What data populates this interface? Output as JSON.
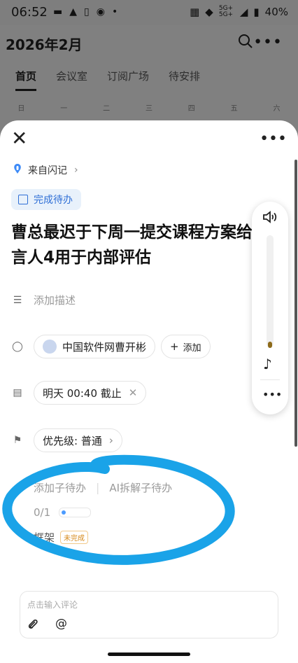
{
  "status_bar": {
    "time": "06:52",
    "network": "5G+ 5G+",
    "battery": "40%"
  },
  "background_app": {
    "month_title": "2026年2月",
    "tabs": [
      "首页",
      "会议室",
      "订阅广场",
      "待安排"
    ],
    "weekdays": [
      "日",
      "一",
      "二",
      "三",
      "四",
      "五",
      "六"
    ]
  },
  "sheet": {
    "source_label": "来自闪记",
    "todo_chip_label": "完成待办",
    "title": "曹总最迟于下周一提交课程方案给言人4用于内部评估",
    "title_line1": "曹总最迟于下周一提交课程方案给",
    "title_line2": "言人4用于内部评估",
    "description_placeholder": "添加描述",
    "assignee": {
      "name": "中国软件网曹开彬",
      "add_label": "添加"
    },
    "deadline": "明天 00:40 截止",
    "priority": "优先级: 普通",
    "subtasks": {
      "add_label": "添加子待办",
      "ai_label": "AI拆解子待办",
      "progress_text": "0/1",
      "progress_fraction": 0
    },
    "subtask_item": {
      "name": "框架",
      "status": "未完成"
    },
    "comment": {
      "placeholder": "点击输入评论",
      "at_symbol": "@"
    }
  },
  "colors": {
    "accent": "#2f6fd6",
    "chip_bg": "#e8f1fb",
    "scribble": "#1aa3e8",
    "badge": "#d68a1c"
  },
  "icons": {
    "close": "close-icon",
    "more": "more-icon",
    "source": "voice-note-icon",
    "volume": "speaker-icon",
    "music": "music-note-icon"
  }
}
